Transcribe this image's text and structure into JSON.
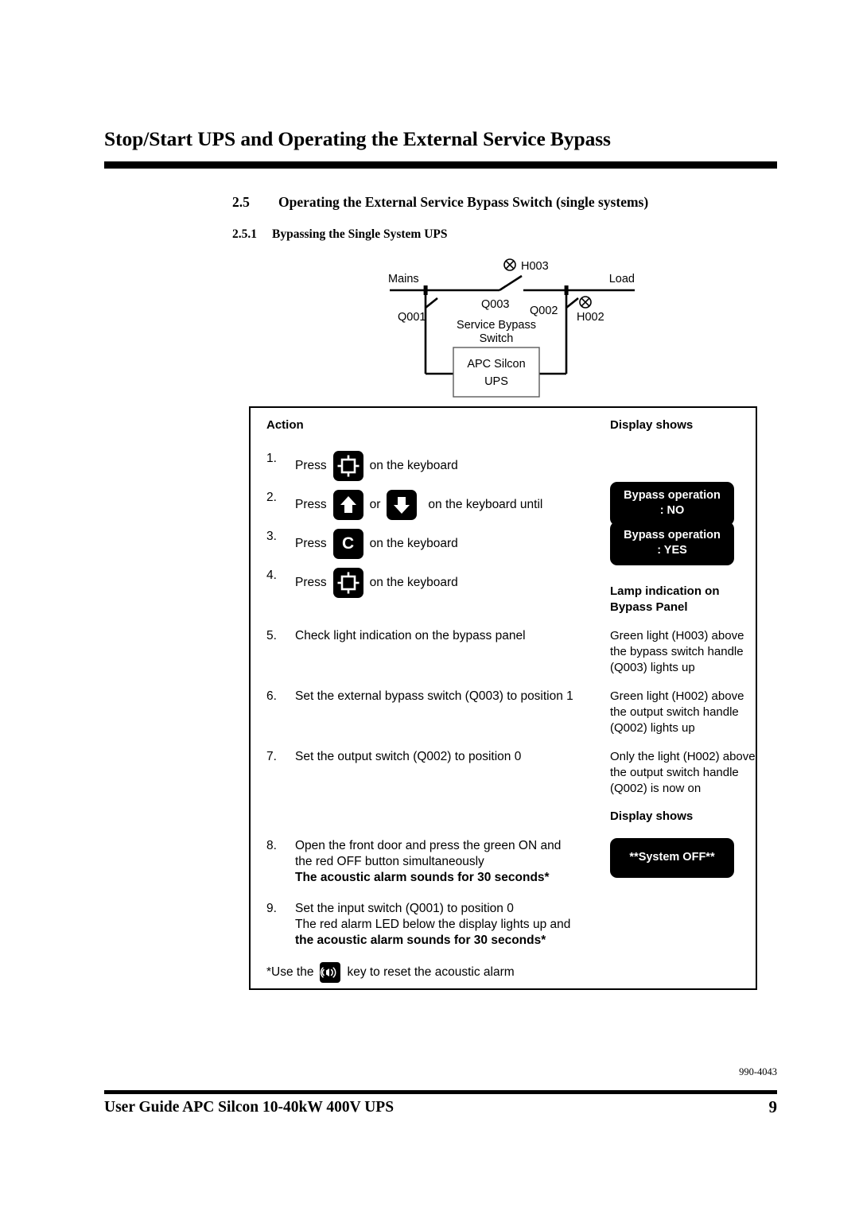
{
  "header": {
    "title": "Stop/Start UPS and Operating the External Service Bypass"
  },
  "section": {
    "number": "2.5",
    "title": "Operating the External Service Bypass Switch (single systems)"
  },
  "subsection": {
    "number": "2.5.1",
    "title": "Bypassing the Single System UPS"
  },
  "diagram": {
    "labels": {
      "mains": "Mains",
      "load": "Load",
      "lamp_h003": "H003",
      "lamp_h002": "H002",
      "switch_q001": "Q001",
      "switch_q002": "Q002",
      "switch_q003": "Q003",
      "service_bypass_line1": "Service Bypass",
      "service_bypass_line2": "Switch",
      "ups_line1": "APC Silcon",
      "ups_line2": "UPS"
    }
  },
  "table": {
    "col_action_header": "Action",
    "col_display_header": "Display shows",
    "steps": [
      {
        "number": "1.",
        "press_label": "Press",
        "key": "frame-key",
        "tail": "on the keyboard"
      },
      {
        "number": "2.",
        "press_label": "Press",
        "key": "arrow-up-key",
        "conjunction": "or",
        "key2": "arrow-down-key",
        "tail": "on the keyboard until"
      },
      {
        "number": "3.",
        "press_label": "Press",
        "key": "letter-c-key",
        "key_label": "C",
        "tail": "on the keyboard"
      },
      {
        "number": "4.",
        "press_label": "Press",
        "key": "frame-key",
        "tail": "on the keyboard"
      },
      {
        "number": "5.",
        "text": "Check light indication on the bypass panel"
      },
      {
        "number": "6.",
        "text": "Set the external bypass switch (Q003) to position 1"
      },
      {
        "number": "7.",
        "text": "Set the output switch (Q002) to position 0"
      },
      {
        "number": "8.",
        "line1": "Open the front door and press the green ON and",
        "line2": "the red OFF button simultaneously",
        "line3_bold": "The acoustic alarm sounds for 30 seconds*"
      },
      {
        "number": "9.",
        "line1": "Set the input switch (Q001) to position 0",
        "line2": "The red alarm LED below the display lights up and",
        "line3_bold": "the acoustic alarm sounds for 30 seconds*"
      }
    ],
    "footnote": {
      "prefix": "*Use the",
      "key": "alarm-silence-key",
      "suffix": "key  to reset the acoustic alarm"
    },
    "display_column": {
      "header_1": "Display shows",
      "lcd_bypass_no_line1": "Bypass operation",
      "lcd_bypass_no_line2": ": NO",
      "lcd_bypass_yes_line1": "Bypass operation",
      "lcd_bypass_yes_line2": ": YES",
      "lamp_header_line1": "Lamp indication on",
      "lamp_header_line2": "Bypass Panel",
      "lamp_5": "Green light (H003) above the bypass switch handle (Q003) lights up",
      "lamp_6": "Green light (H002) above the output switch handle (Q002) lights up",
      "lamp_7": "Only the light (H002) above the output switch handle (Q002) is now on",
      "header_2": "Display shows",
      "lcd_system_off": "**System OFF**"
    }
  },
  "footer": {
    "doc_code": "990-4043",
    "guide_title": "User Guide APC Silcon 10-40kW 400V UPS",
    "page_number": "9"
  }
}
